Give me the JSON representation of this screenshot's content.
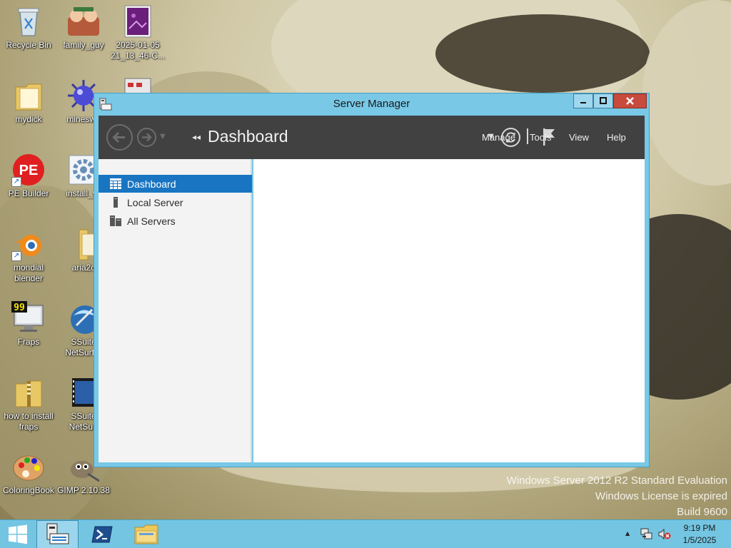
{
  "desktop": {
    "icons": [
      {
        "label": "Recycle Bin",
        "icon": "recycle-bin-icon"
      },
      {
        "label": "family_guy",
        "icon": "family-guy-icon"
      },
      {
        "label": "2025-01-05\n21_13_46-C...",
        "icon": "image-file-icon"
      },
      {
        "label": "mydick",
        "icon": "folder-icon"
      },
      {
        "label": "mineswe",
        "icon": "minesweeper-icon"
      },
      {
        "label": "PE Builder",
        "icon": "pe-builder-icon"
      },
      {
        "label": "install_vc",
        "icon": "installer-icon"
      },
      {
        "label": "mondial\nblender",
        "icon": "blender-icon"
      },
      {
        "label": "aria2c",
        "icon": "folder-icon"
      },
      {
        "label": "Fraps",
        "icon": "fraps-icon"
      },
      {
        "label": "SSuite\nNetSurfer",
        "icon": "netsurfer-icon"
      },
      {
        "label": "how to install\nfraps",
        "icon": "zip-folder-icon"
      },
      {
        "label": "SSuite\nNetSurf",
        "icon": "video-file-icon"
      },
      {
        "label": "ColoringBook",
        "icon": "palette-icon"
      },
      {
        "label": "GIMP 2.10.38",
        "icon": "gimp-icon"
      }
    ],
    "watermark": [
      "Windows Server 2012 R2 Standard Evaluation",
      "Windows License is expired",
      "Build 9600"
    ]
  },
  "window": {
    "title": "Server Manager",
    "breadcrumb": "Dashboard",
    "menus": [
      "Manage",
      "Tools",
      "View",
      "Help"
    ],
    "nav": [
      {
        "label": "Dashboard",
        "icon": "dashboard-grid-icon",
        "selected": true
      },
      {
        "label": "Local Server",
        "icon": "server-icon",
        "selected": false
      },
      {
        "label": "All Servers",
        "icon": "servers-icon",
        "selected": false
      }
    ],
    "caption_buttons": {
      "minimize": "minimize-icon",
      "maximize": "maximize-icon",
      "close": "x"
    }
  },
  "taskbar": {
    "time": "9:19 PM",
    "date": "1/5/2025"
  },
  "colors": {
    "accent": "#1975c2",
    "window_border": "#78c8e6",
    "toolbar": "#414141",
    "taskbar": "#74c5e2",
    "close_button": "#c74a3c"
  }
}
